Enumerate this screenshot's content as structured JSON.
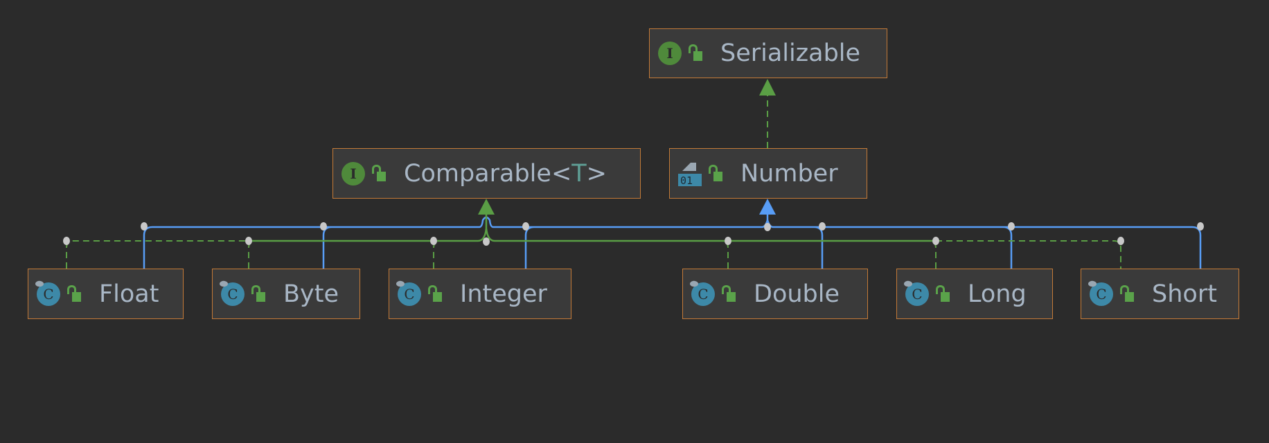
{
  "diagram": {
    "colors": {
      "background": "#2b2b2b",
      "node_border": "#c47a37",
      "text": "#a9b7c6",
      "extends": "#589df6",
      "implements": "#5a9e45"
    },
    "nodes": {
      "serializable": {
        "name": "Serializable",
        "kind": "interface",
        "icon": "interface-icon",
        "icon_letter": "I"
      },
      "comparable": {
        "name": "Comparable",
        "type_param_open": "<",
        "type_param": "T",
        "type_param_close": ">",
        "kind": "interface",
        "icon": "interface-icon",
        "icon_letter": "I"
      },
      "number": {
        "name": "Number",
        "kind": "abstract-class",
        "icon": "abstract-class-icon",
        "icon_text": "01"
      },
      "float": {
        "name": "Float",
        "kind": "class",
        "icon": "class-icon",
        "icon_letter": "C"
      },
      "byte": {
        "name": "Byte",
        "kind": "class",
        "icon": "class-icon",
        "icon_letter": "C"
      },
      "integer": {
        "name": "Integer",
        "kind": "class",
        "icon": "class-icon",
        "icon_letter": "C"
      },
      "double": {
        "name": "Double",
        "kind": "class",
        "icon": "class-icon",
        "icon_letter": "C"
      },
      "long": {
        "name": "Long",
        "kind": "class",
        "icon": "class-icon",
        "icon_letter": "C"
      },
      "short": {
        "name": "Short",
        "kind": "class",
        "icon": "class-icon",
        "icon_letter": "C"
      }
    },
    "edges": [
      {
        "from": "Number",
        "to": "Serializable",
        "type": "implements"
      },
      {
        "from": "Float",
        "to": "Number",
        "type": "extends"
      },
      {
        "from": "Byte",
        "to": "Number",
        "type": "extends"
      },
      {
        "from": "Integer",
        "to": "Number",
        "type": "extends"
      },
      {
        "from": "Double",
        "to": "Number",
        "type": "extends"
      },
      {
        "from": "Long",
        "to": "Number",
        "type": "extends"
      },
      {
        "from": "Short",
        "to": "Number",
        "type": "extends"
      },
      {
        "from": "Float",
        "to": "Comparable",
        "type": "implements"
      },
      {
        "from": "Byte",
        "to": "Comparable",
        "type": "implements"
      },
      {
        "from": "Integer",
        "to": "Comparable",
        "type": "implements"
      },
      {
        "from": "Double",
        "to": "Comparable",
        "type": "implements"
      },
      {
        "from": "Long",
        "to": "Comparable",
        "type": "implements"
      },
      {
        "from": "Short",
        "to": "Comparable",
        "type": "implements"
      }
    ]
  }
}
